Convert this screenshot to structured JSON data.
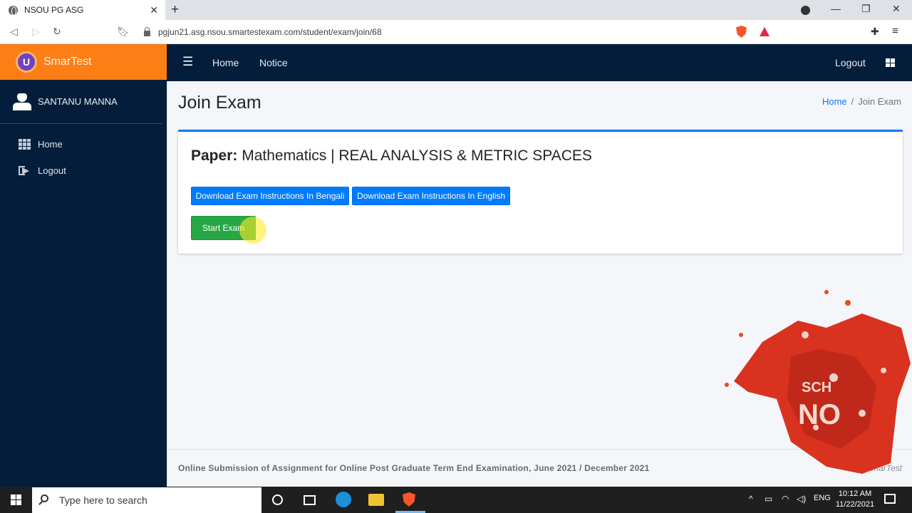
{
  "browser": {
    "tab_title": "NSOU PG ASG",
    "url": "pgjun21.asg.nsou.smartestexam.com/student/exam/join/68"
  },
  "app": {
    "brand": "SmarTest",
    "topnav": {
      "home": "Home",
      "notice": "Notice",
      "logout": "Logout"
    },
    "user_name": "SANTANU MANNA",
    "sidebar": {
      "home": "Home",
      "logout": "Logout"
    }
  },
  "page": {
    "title": "Join Exam",
    "breadcrumb": {
      "home": "Home",
      "separator": "/",
      "current": "Join Exam"
    },
    "paper_label": "Paper:",
    "paper_value": "Mathematics | REAL ANALYSIS & METRIC SPACES",
    "btn_bengali": "Download Exam Instructions In Bengali",
    "btn_english": "Download Exam Instructions In English",
    "btn_start": "Start Exam"
  },
  "footer": {
    "text": "Online Submission of Assignment for Online Post Graduate Term End Examination, June 2021 / December 2021",
    "right": "marTest"
  },
  "taskbar": {
    "search_placeholder": "Type here to search",
    "lang": "ENG",
    "time": "10:12 AM",
    "date": "11/22/2021"
  },
  "colors": {
    "brand_orange": "#fd7e14",
    "nav_dark": "#031d3a",
    "primary": "#007bff",
    "success": "#28a745"
  }
}
